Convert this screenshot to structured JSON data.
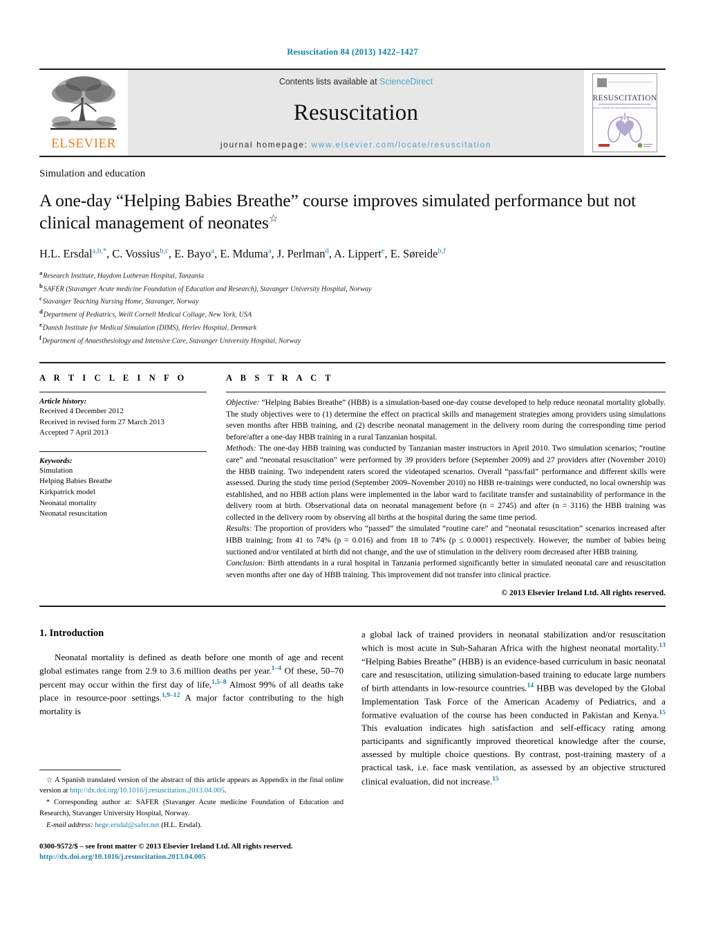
{
  "running_head": "Resuscitation 84 (2013) 1422–1427",
  "masthead": {
    "publisher_name": "ELSEVIER",
    "contents_prefix": "Contents lists available at ",
    "contents_link": "ScienceDirect",
    "journal_name": "Resuscitation",
    "homepage_prefix": "journal homepage: ",
    "homepage_url": "www.elsevier.com/locate/resuscitation",
    "cover_title": "RESUSCITATION",
    "cover_subtitle": "OFFICIAL JOURNAL OF THE EUROPEAN RESUSCITATION COUNCIL",
    "accent_blue": "#4ea3cf",
    "elsevier_orange": "#f07c24",
    "cover_purple": "#7a6aa5"
  },
  "article": {
    "section_kicker": "Simulation and education",
    "title": "A one-day “Helping Babies Breathe” course improves simulated performance but not clinical management of neonates",
    "title_footnote_mark": "☆",
    "authors_html": "H.L. Ersdal<sup>a,b,</sup><sup>*</sup>, C. Vossius<sup>b,c</sup>, E. Bayo<sup>a</sup>, E. Mduma<sup>a</sup>, J. Perlman<sup>d</sup>, A. Lippert<sup>e</sup>, E. Søreide<sup>b,f</sup>",
    "affiliations": [
      {
        "mark": "a",
        "text": "Research Institute, Haydom Lutheran Hospital, Tanzania"
      },
      {
        "mark": "b",
        "text": "SAFER (Stavanger Acute medicine Foundation of Education and Research), Stavanger University Hospital, Norway"
      },
      {
        "mark": "c",
        "text": "Stavanger Teaching Nursing Home, Stavanger, Norway"
      },
      {
        "mark": "d",
        "text": "Department of Pediatrics, Weill Cornell Medical Collage, New York, USA"
      },
      {
        "mark": "e",
        "text": "Danish Institute for Medical Simulation (DIMS), Herlev Hospital, Denmark"
      },
      {
        "mark": "f",
        "text": "Department of Anaesthesiology and Intensive Care, Stavanger University Hospital, Norway"
      }
    ]
  },
  "article_info": {
    "heading": "A R T I C L E  I N F O",
    "history_label": "Article history:",
    "history": [
      "Received 4 December 2012",
      "Received in revised form 27 March 2013",
      "Accepted 7 April 2013"
    ],
    "keywords_label": "Keywords:",
    "keywords": [
      "Simulation",
      "Helping Babies Breathe",
      "Kirkpatrick model",
      "Neonatal mortality",
      "Neonatal resuscitation"
    ]
  },
  "abstract": {
    "heading": "A B S T R A C T",
    "objective_label": "Objective:",
    "objective_text": " “Helping Babies Breathe” (HBB) is a simulation-based one-day course developed to help reduce neonatal mortality globally. The study objectives were to (1) determine the effect on practical skills and management strategies among providers using simulations seven months after HBB training, and (2) describe neonatal management in the delivery room during the corresponding time period before/after a one-day HBB training in a rural Tanzanian hospital.",
    "methods_label": "Methods:",
    "methods_text": " The one-day HBB training was conducted by Tanzanian master instructors in April 2010. Two simulation scenarios; “routine care” and “neonatal resuscitation” were performed by 39 providers before (September 2009) and 27 providers after (November 2010) the HBB training. Two independent raters scored the videotaped scenarios. Overall “pass/fail” performance and different skills were assessed. During the study time period (September 2009–November 2010) no HBB re-trainings were conducted, no local ownership was established, and no HBB action plans were implemented in the labor ward to facilitate transfer and sustainability of performance in the delivery room at birth. Observational data on neonatal management before (n = 2745) and after (n = 3116) the HBB training was collected in the delivery room by observing all births at the hospital during the same time period.",
    "results_label": "Results:",
    "results_text": " The proportion of providers who “passed” the simulated “routine care” and “neonatal resuscitation” scenarios increased after HBB training; from 41 to 74% (p = 0.016) and from 18 to 74% (p ≤ 0.0001) respectively. However, the number of babies being suctioned and/or ventilated at birth did not change, and the use of stimulation in the delivery room decreased after HBB training.",
    "conclusion_label": "Conclusion:",
    "conclusion_text": " Birth attendants in a rural hospital in Tanzania performed significantly better in simulated neonatal care and resuscitation seven months after one day of HBB training. This improvement did not transfer into clinical practice.",
    "copyright": "© 2013 Elsevier Ireland Ltd. All rights reserved."
  },
  "introduction": {
    "heading": "1.  Introduction",
    "left_paragraph_parts": [
      "Neonatal mortality is defined as death before one month of age and recent global estimates range from 2.9 to 3.6 million deaths per year.",
      "1–4",
      " Of these, 50–70 percent may occur within the first day of life,",
      "1,5–8",
      " Almost 99% of all deaths take place in resource-poor settings.",
      "1,9–12",
      " A major factor contributing to the high mortality is"
    ],
    "right_paragraph_parts": [
      "a global lack of trained providers in neonatal stabilization and/or resuscitation which is most acute in Sub-Saharan Africa with the highest neonatal mortality.",
      "13",
      " “Helping Babies Breathe” (HBB) is an evidence-based curriculum in basic neonatal care and resuscitation, utilizing simulation-based training to educate large numbers of birth attendants in low-resource countries.",
      "14",
      " HBB was developed by the Global Implementation Task Force of the American Academy of Pediatrics, and a formative evaluation of the course has been conducted in Pakistan and Kenya.",
      "15",
      " This evaluation indicates high satisfaction and self-efficacy rating among participants and significantly improved theoretical knowledge after the course, assessed by multiple choice questions. By contrast, post-training mastery of a practical task, i.e. face mask ventilation, as assessed by an objective structured clinical evaluation, did not increase.",
      "15"
    ]
  },
  "footnotes": {
    "star_symbol": "☆",
    "star_text_a": " A Spanish translated version of the abstract of this article appears as Appendix in the final online version at ",
    "star_link": "http://dx.doi.org/10.1016/j.resuscitation.2013.04.005",
    "star_text_b": ".",
    "corr_symbol": "*",
    "corr_text": " Corresponding author at: SAFER (Stavanger Acute medicine Foundation of Education and Research), Stavanger University Hospital, Norway.",
    "email_label": "E-mail address:",
    "email": "hege.ersdal@safer.net",
    "email_suffix": " (H.L. Ersdal).",
    "issn_line": "0300-9572/$ – see front matter © 2013 Elsevier Ireland Ltd. All rights reserved.",
    "doi_link": "http://dx.doi.org/10.1016/j.resuscitation.2013.04.005"
  }
}
